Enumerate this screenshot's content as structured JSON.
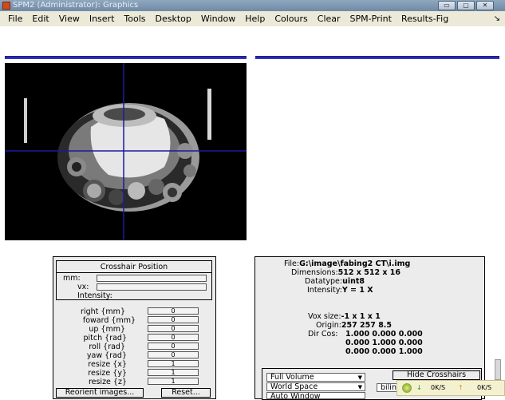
{
  "window": {
    "title": "SPM2 (Administrator): Graphics",
    "buttons": {
      "minimize": "▭",
      "maximize": "▢",
      "close": "✕"
    }
  },
  "menubar": {
    "items": [
      "File",
      "Edit",
      "View",
      "Insert",
      "Tools",
      "Desktop",
      "Window",
      "Help",
      "Colours",
      "Clear",
      "SPM-Print",
      "Results-Fig"
    ],
    "arrow": "↘"
  },
  "crosshair_panel": {
    "title": "Crosshair Position",
    "mm_label": "mm:",
    "vx_label": "vx:",
    "intensity_label": "Intensity:"
  },
  "reorient": {
    "rows": [
      {
        "label": "right  {mm}",
        "value": "0"
      },
      {
        "label": "foward  {mm}",
        "value": "0"
      },
      {
        "label": "up  {mm}",
        "value": "0"
      },
      {
        "label": "pitch  {rad}",
        "value": "0"
      },
      {
        "label": "roll  {rad}",
        "value": "0"
      },
      {
        "label": "yaw  {rad}",
        "value": "0"
      },
      {
        "label": "resize  {x}",
        "value": "1"
      },
      {
        "label": "resize  {y}",
        "value": "1"
      },
      {
        "label": "resize  {z}",
        "value": "1"
      }
    ],
    "reorient_button": "Reorient images...",
    "reset_button": "Reset..."
  },
  "file_info": {
    "file_label": "File:",
    "file_value": "G:\\image\\fabing2 CT\\i.img",
    "dimensions_label": "Dimensions:",
    "dimensions_value": "512 x 512 x 16",
    "datatype_label": "Datatype:",
    "datatype_value": "uint8",
    "intensity_label": "Intensity:",
    "intensity_value": "Y = 1 X",
    "voxsize_label": "Vox size:",
    "voxsize_value": "-1 x 1 x 1",
    "origin_label": "Origin:",
    "origin_value": "257 257 8.5",
    "dircos_label": "Dir Cos:",
    "dircos_rows": [
      "1.000  0.000  0.000",
      "0.000  1.000  0.000",
      "0.000  0.000  1.000"
    ]
  },
  "controls": {
    "view_select": "Full Volume",
    "space_select": "World Space",
    "window_select": "Auto Window",
    "hide_crosshairs": "Hide Crosshairs",
    "interp_select": "bilin"
  },
  "taskbar": {
    "down_rate": "0K/S",
    "up_rate": "0K/S"
  },
  "colors": {
    "titlebar": "#7a93ad",
    "menubar": "#ece9d8",
    "crosshair": "#1a1aa0",
    "panel": "#ececec"
  }
}
